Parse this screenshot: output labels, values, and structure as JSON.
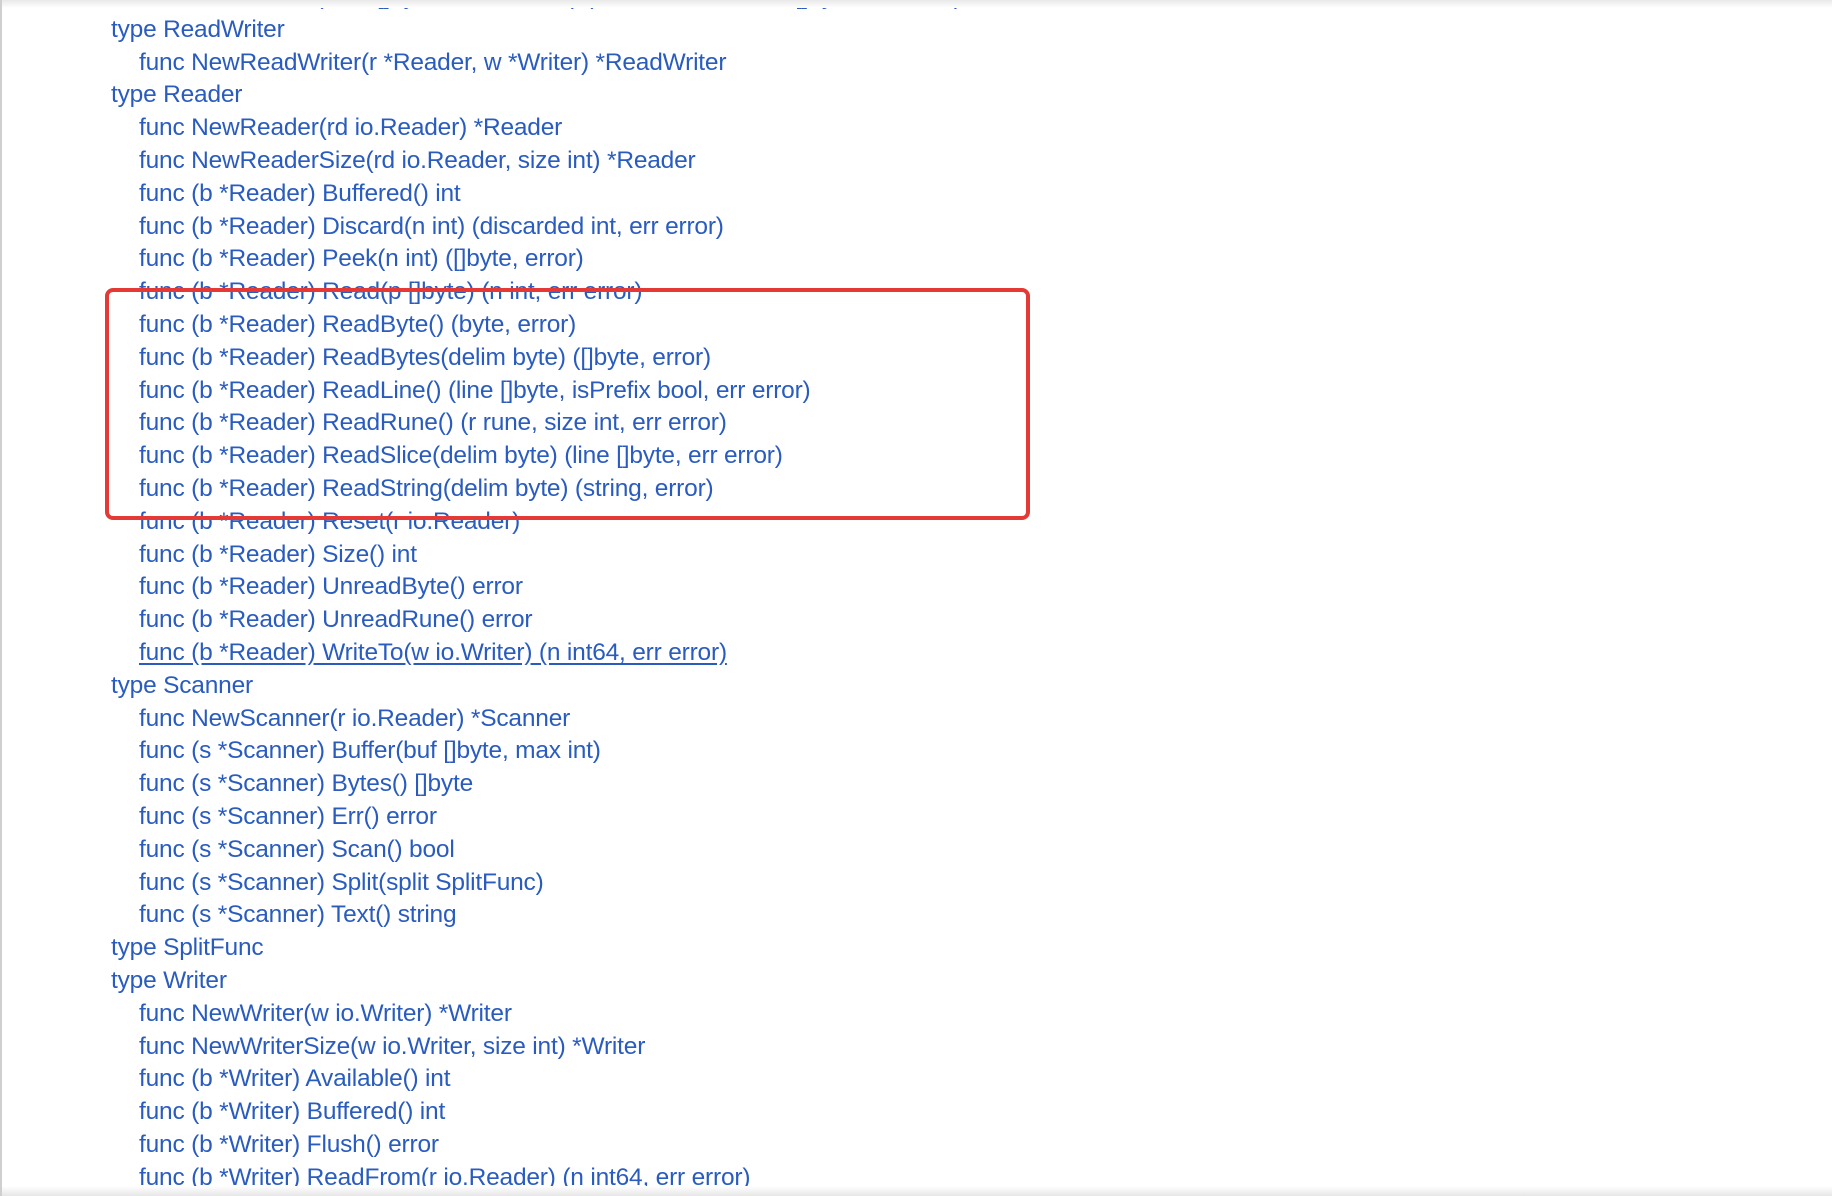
{
  "index": {
    "entries": [
      {
        "text": "func ScanWords(data []byte, atEOF bool) (advance int, token []byte, err error)",
        "level": 1,
        "link": false
      },
      {
        "text": "type ReadWriter",
        "level": 0,
        "link": false
      },
      {
        "text": "func NewReadWriter(r *Reader, w *Writer) *ReadWriter",
        "level": 1,
        "link": false
      },
      {
        "text": "type Reader",
        "level": 0,
        "link": false
      },
      {
        "text": "func NewReader(rd io.Reader) *Reader",
        "level": 1,
        "link": false
      },
      {
        "text": "func NewReaderSize(rd io.Reader, size int) *Reader",
        "level": 1,
        "link": false
      },
      {
        "text": "func (b *Reader) Buffered() int",
        "level": 1,
        "link": false
      },
      {
        "text": "func (b *Reader) Discard(n int) (discarded int, err error)",
        "level": 1,
        "link": false
      },
      {
        "text": "func (b *Reader) Peek(n int) ([]byte, error)",
        "level": 1,
        "link": false
      },
      {
        "text": "func (b *Reader) Read(p []byte) (n int, err error)",
        "level": 1,
        "link": false
      },
      {
        "text": "func (b *Reader) ReadByte() (byte, error)",
        "level": 1,
        "link": false
      },
      {
        "text": "func (b *Reader) ReadBytes(delim byte) ([]byte, error)",
        "level": 1,
        "link": false
      },
      {
        "text": "func (b *Reader) ReadLine() (line []byte, isPrefix bool, err error)",
        "level": 1,
        "link": false
      },
      {
        "text": "func (b *Reader) ReadRune() (r rune, size int, err error)",
        "level": 1,
        "link": false
      },
      {
        "text": "func (b *Reader) ReadSlice(delim byte) (line []byte, err error)",
        "level": 1,
        "link": false
      },
      {
        "text": "func (b *Reader) ReadString(delim byte) (string, error)",
        "level": 1,
        "link": false
      },
      {
        "text": "func (b *Reader) Reset(r io.Reader)",
        "level": 1,
        "link": false
      },
      {
        "text": "func (b *Reader) Size() int",
        "level": 1,
        "link": false
      },
      {
        "text": "func (b *Reader) UnreadByte() error",
        "level": 1,
        "link": false
      },
      {
        "text": "func (b *Reader) UnreadRune() error",
        "level": 1,
        "link": false
      },
      {
        "text": "func (b *Reader) WriteTo(w io.Writer) (n int64, err error)",
        "level": 1,
        "link": true
      },
      {
        "text": "type Scanner",
        "level": 0,
        "link": false
      },
      {
        "text": "func NewScanner(r io.Reader) *Scanner",
        "level": 1,
        "link": false
      },
      {
        "text": "func (s *Scanner) Buffer(buf []byte, max int)",
        "level": 1,
        "link": false
      },
      {
        "text": "func (s *Scanner) Bytes() []byte",
        "level": 1,
        "link": false
      },
      {
        "text": "func (s *Scanner) Err() error",
        "level": 1,
        "link": false
      },
      {
        "text": "func (s *Scanner) Scan() bool",
        "level": 1,
        "link": false
      },
      {
        "text": "func (s *Scanner) Split(split SplitFunc)",
        "level": 1,
        "link": false
      },
      {
        "text": "func (s *Scanner) Text() string",
        "level": 1,
        "link": false
      },
      {
        "text": "type SplitFunc",
        "level": 0,
        "link": false
      },
      {
        "text": "type Writer",
        "level": 0,
        "link": false
      },
      {
        "text": "func NewWriter(w io.Writer) *Writer",
        "level": 1,
        "link": false
      },
      {
        "text": "func NewWriterSize(w io.Writer, size int) *Writer",
        "level": 1,
        "link": false
      },
      {
        "text": "func (b *Writer) Available() int",
        "level": 1,
        "link": false
      },
      {
        "text": "func (b *Writer) Buffered() int",
        "level": 1,
        "link": false
      },
      {
        "text": "func (b *Writer) Flush() error",
        "level": 1,
        "link": false
      },
      {
        "text": "func (b *Writer) ReadFrom(r io.Reader) (n int64, err error)",
        "level": 1,
        "link": false
      }
    ]
  },
  "colors": {
    "link": "#2a5cbf",
    "highlight": "#e53935",
    "background": "#ffffff"
  }
}
